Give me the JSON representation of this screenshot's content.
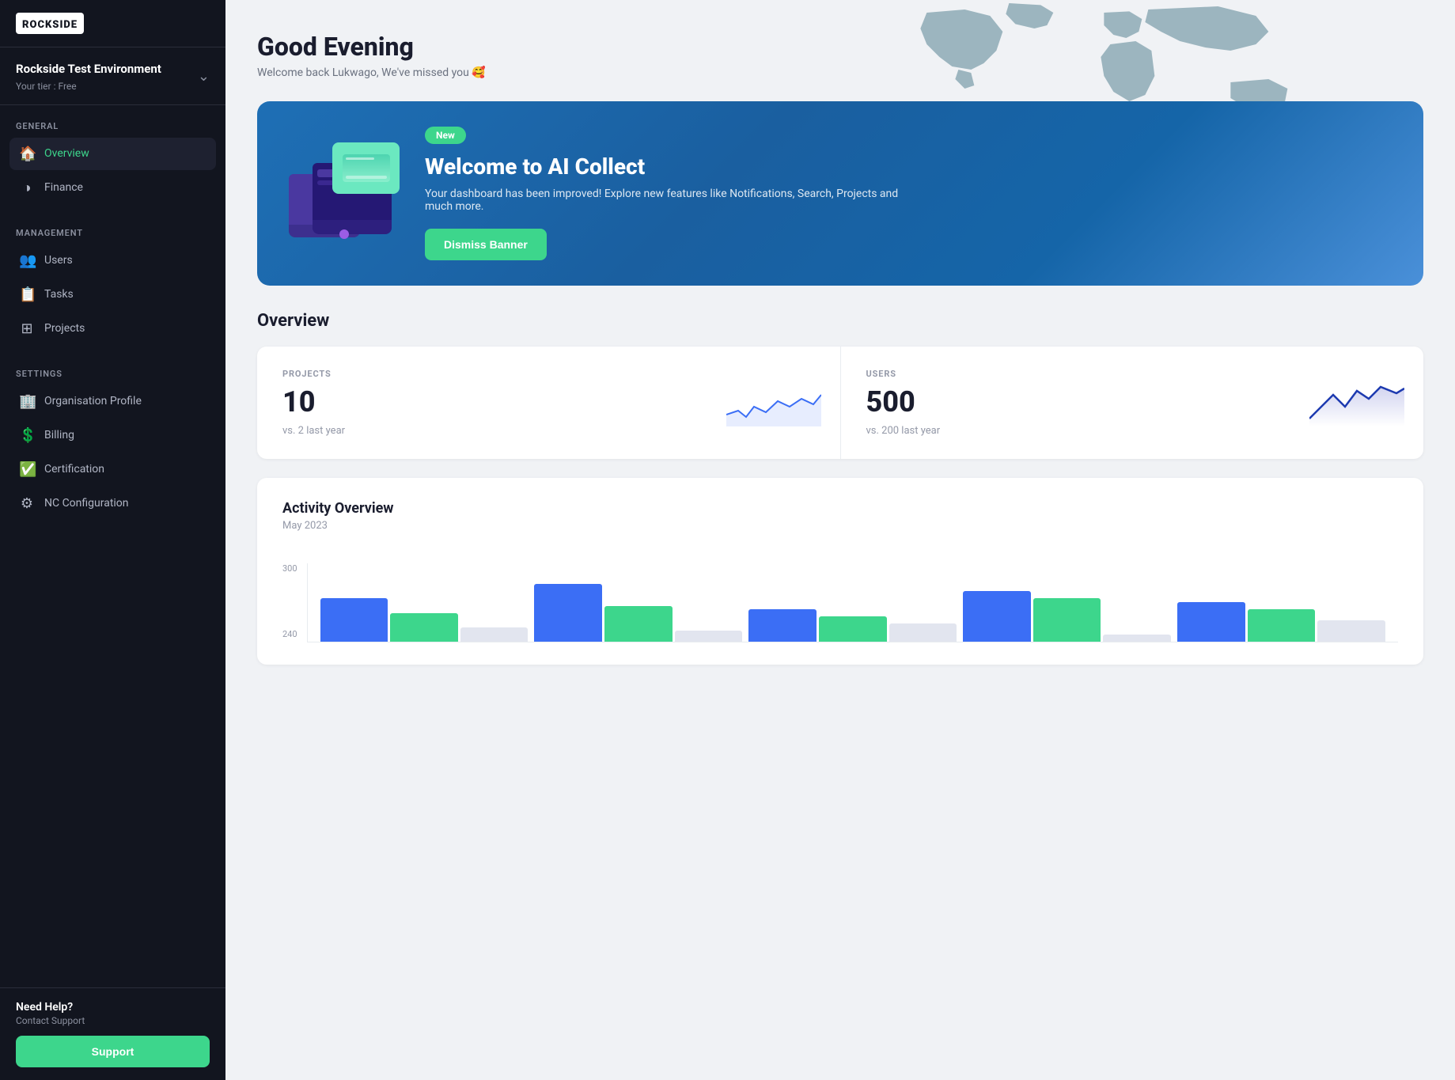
{
  "sidebar": {
    "logo": "ROCKSIDE",
    "org": {
      "name": "Rockside Test Environment",
      "tier": "Your tier : Free"
    },
    "sections": [
      {
        "label": "GENERAL",
        "items": [
          {
            "id": "overview",
            "label": "Overview",
            "icon": "🏠",
            "active": true
          },
          {
            "id": "finance",
            "label": "Finance",
            "icon": "◑"
          }
        ]
      },
      {
        "label": "MANAGEMENT",
        "items": [
          {
            "id": "users",
            "label": "Users",
            "icon": "👥"
          },
          {
            "id": "tasks",
            "label": "Tasks",
            "icon": "📋"
          },
          {
            "id": "projects",
            "label": "Projects",
            "icon": "⊞"
          }
        ]
      },
      {
        "label": "SETTINGS",
        "items": [
          {
            "id": "org-profile",
            "label": "Organisation Profile",
            "icon": "🏢"
          },
          {
            "id": "billing",
            "label": "Billing",
            "icon": "💲"
          },
          {
            "id": "certification",
            "label": "Certification",
            "icon": "✅"
          },
          {
            "id": "nc-config",
            "label": "NC Configuration",
            "icon": "⚙"
          }
        ]
      }
    ],
    "help": {
      "label": "Need Help?",
      "contact": "Contact Support",
      "button": "Support"
    }
  },
  "header": {
    "greeting": "Good Evening",
    "welcome_message": "Welcome back Lukwago, We've missed you 🥰"
  },
  "banner": {
    "badge": "New",
    "title": "Welcome to AI Collect",
    "description": "Your dashboard has been improved! Explore new features like Notifications, Search, Projects and much more.",
    "dismiss_button": "Dismiss Banner"
  },
  "overview": {
    "title": "Overview",
    "stats": [
      {
        "label": "PROJECTS",
        "value": "10",
        "comparison": "vs. 2  last year"
      },
      {
        "label": "USERS",
        "value": "500",
        "comparison": "vs. 200  last year"
      }
    ]
  },
  "activity": {
    "title": "Activity Overview",
    "date": "May 2023",
    "y_labels": [
      "300",
      "240"
    ],
    "bars": [
      {
        "blue": 60,
        "green": 40,
        "gray": 20
      },
      {
        "blue": 80,
        "green": 50,
        "gray": 15
      },
      {
        "blue": 45,
        "green": 35,
        "gray": 25
      },
      {
        "blue": 70,
        "green": 60,
        "gray": 10
      },
      {
        "blue": 55,
        "green": 45,
        "gray": 30
      }
    ]
  }
}
